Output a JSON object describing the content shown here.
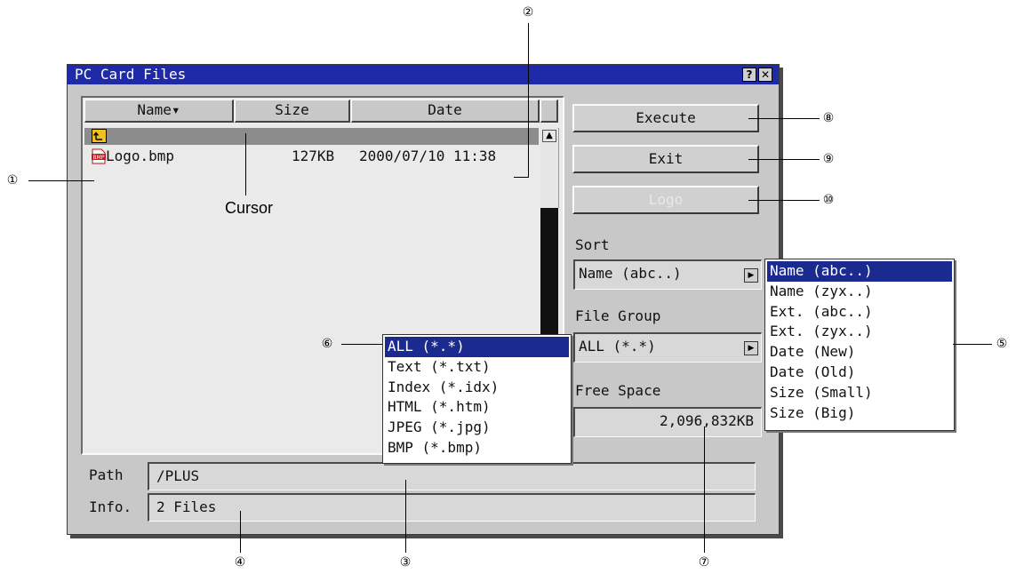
{
  "window": {
    "title": "PC Card Files",
    "help_label": "?",
    "close_label": "✕"
  },
  "file_list": {
    "columns": [
      "Name▾",
      "Size",
      "Date"
    ],
    "rows": [
      {
        "name": "",
        "size": "",
        "date": "",
        "icon": "folder-up-icon",
        "highlighted": true
      },
      {
        "name": "Logo.bmp",
        "size": "127KB",
        "date": "2000/07/10 11:38",
        "icon": "bmp-file-icon",
        "highlighted": false
      }
    ],
    "scroll_up": "▲"
  },
  "buttons": {
    "execute": "Execute",
    "exit": "Exit",
    "logo": "Logo"
  },
  "sort": {
    "label": "Sort",
    "value": "Name (abc..)",
    "options": [
      "Name (abc..)",
      "Name (zyx..)",
      "Ext.  (abc..)",
      "Ext.  (zyx..)",
      "Date (New)",
      "Date (Old)",
      "Size (Small)",
      "Size (Big)"
    ]
  },
  "file_group": {
    "label": "File Group",
    "value": "ALL (*.*)",
    "options": [
      "ALL (*.*)",
      "Text (*.txt)",
      "Index (*.idx)",
      "HTML (*.htm)",
      "JPEG (*.jpg)",
      "BMP (*.bmp)"
    ]
  },
  "free_space": {
    "label": "Free Space",
    "value": "2,096,832KB"
  },
  "path": {
    "label": "Path",
    "value": "/PLUS"
  },
  "info": {
    "label": "Info.",
    "value": "2 Files"
  },
  "dropdown_arrow": "▶",
  "annotations": {
    "cursor_label": "Cursor",
    "callouts": [
      "①",
      "②",
      "③",
      "④",
      "⑤",
      "⑥",
      "⑦",
      "⑧",
      "⑨",
      "⑩"
    ]
  },
  "colors": {
    "titlebar": "#1f2aa8",
    "selection": "#1a2a8e",
    "window_bg": "#c8c8c8"
  }
}
